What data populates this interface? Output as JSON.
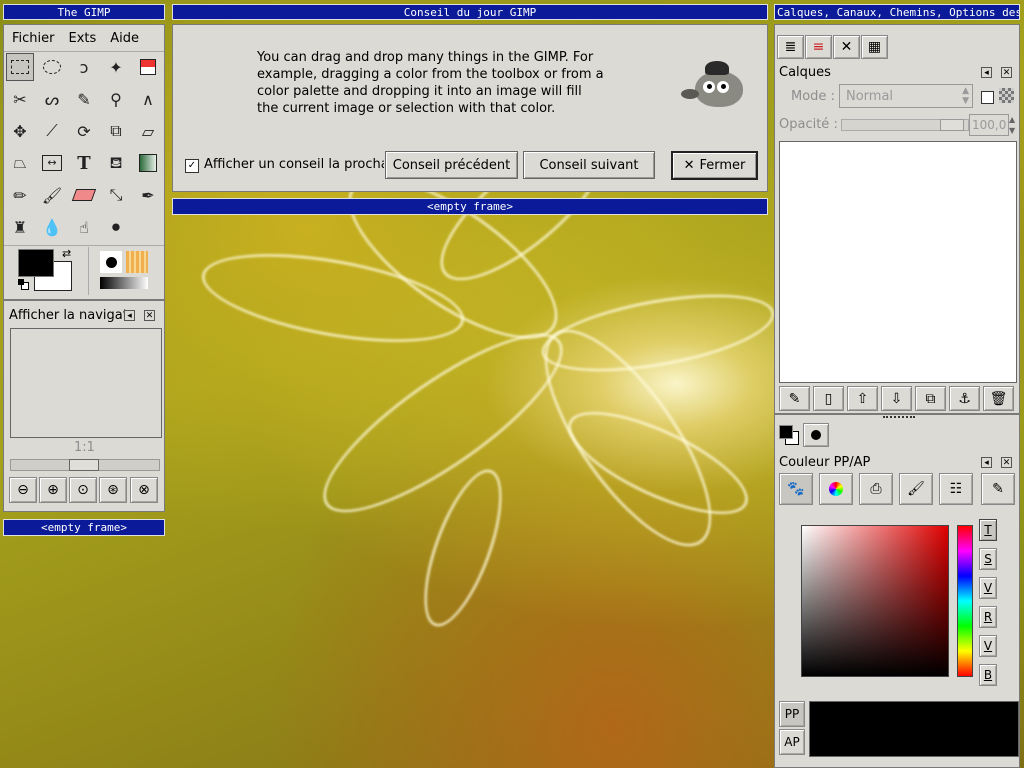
{
  "toolbox": {
    "title": "The GIMP",
    "menu": [
      "Fichier",
      "Exts",
      "Aide"
    ],
    "tools": [
      "rect-select-icon",
      "ellipse-select-icon",
      "lasso-icon",
      "magic-wand-icon",
      "color-select-icon",
      "scissors-icon",
      "paths-icon",
      "color-picker-icon",
      "zoom-icon",
      "measure-icon",
      "move-icon",
      "crop-icon",
      "rotate-icon",
      "scale-icon",
      "shear-icon",
      "perspective-icon",
      "flip-icon",
      "text-icon",
      "bucket-fill-icon",
      "blend-icon",
      "pencil-icon",
      "paintbrush-icon",
      "eraser-icon",
      "airbrush-icon",
      "ink-icon",
      "clone-icon",
      "convolve-icon",
      "smudge-icon",
      "dodge-burn-icon"
    ],
    "text_tool_glyph": "T"
  },
  "navigation": {
    "title": "Afficher la navigat",
    "zoom_ratio": "1:1",
    "frame_label": "<empty frame>"
  },
  "tip_dialog": {
    "title": "Conseil du jour GIMP",
    "text": "You can drag and drop many things in the GIMP. For example, dragging a color from the toolbox or from a color palette and dropping it into an image will fill the current image or selection with that color.",
    "checkbox_label": "Afficher un conseil la prochai",
    "checkbox_checked": true,
    "prev_button": "Conseil précédent",
    "next_button": "Conseil suivant",
    "close_button": "Fermer",
    "frame_label": "<empty frame>"
  },
  "layers_dock": {
    "title": "Calques, Canaux, Chemins, Options des...",
    "panel_title": "Calques",
    "mode_label": "Mode :",
    "mode_value": "Normal",
    "opacity_label": "Opacité :",
    "opacity_value": "100,0"
  },
  "color_dock": {
    "panel_title": "Couleur PP/AP",
    "channels": [
      "T",
      "S",
      "V",
      "R",
      "V",
      "B"
    ],
    "fg_label": "PP",
    "bg_label": "AP"
  },
  "colors": {
    "titlebar": "#0a1a98",
    "panel": "#dcdad5"
  }
}
